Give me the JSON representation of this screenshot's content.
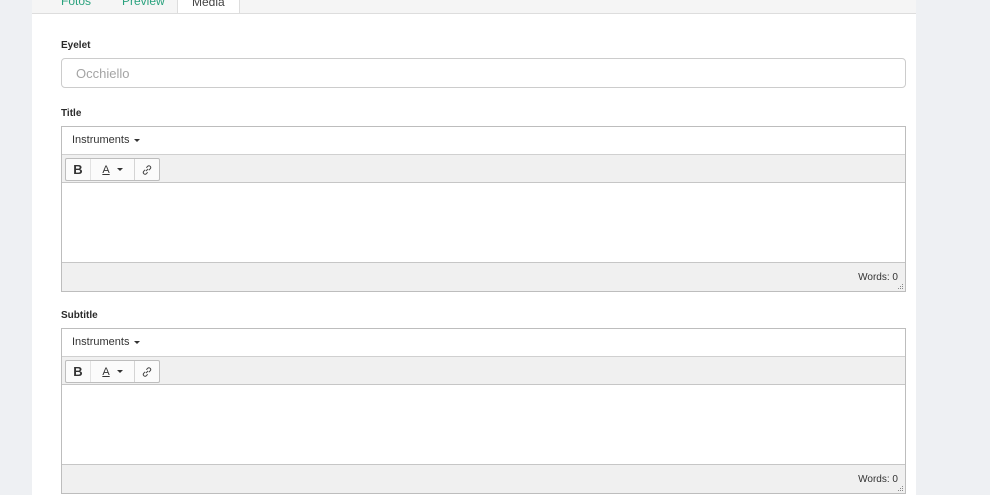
{
  "tabs": [
    {
      "label": "Fotos"
    },
    {
      "label": "Preview"
    },
    {
      "label": "Media"
    }
  ],
  "eyelet": {
    "label": "Eyelet",
    "placeholder": "Occhiello",
    "value": ""
  },
  "title": {
    "label": "Title",
    "menu_label": "Instruments",
    "toolbar": {
      "bold": "B",
      "color": "A"
    },
    "word_count": "Words: 0"
  },
  "subtitle": {
    "label": "Subtitle",
    "menu_label": "Instruments",
    "toolbar": {
      "bold": "B",
      "color": "A"
    },
    "word_count": "Words: 0"
  },
  "icons": {
    "menu_caret": "chevron-down-icon",
    "color_caret": "chevron-down-icon",
    "link": "link-icon",
    "resize": "resize-grip-icon"
  },
  "colors": {
    "tab_link": "#2aa27e",
    "background": "#eef0f3",
    "toolbar_bg": "#f0f0f0"
  }
}
